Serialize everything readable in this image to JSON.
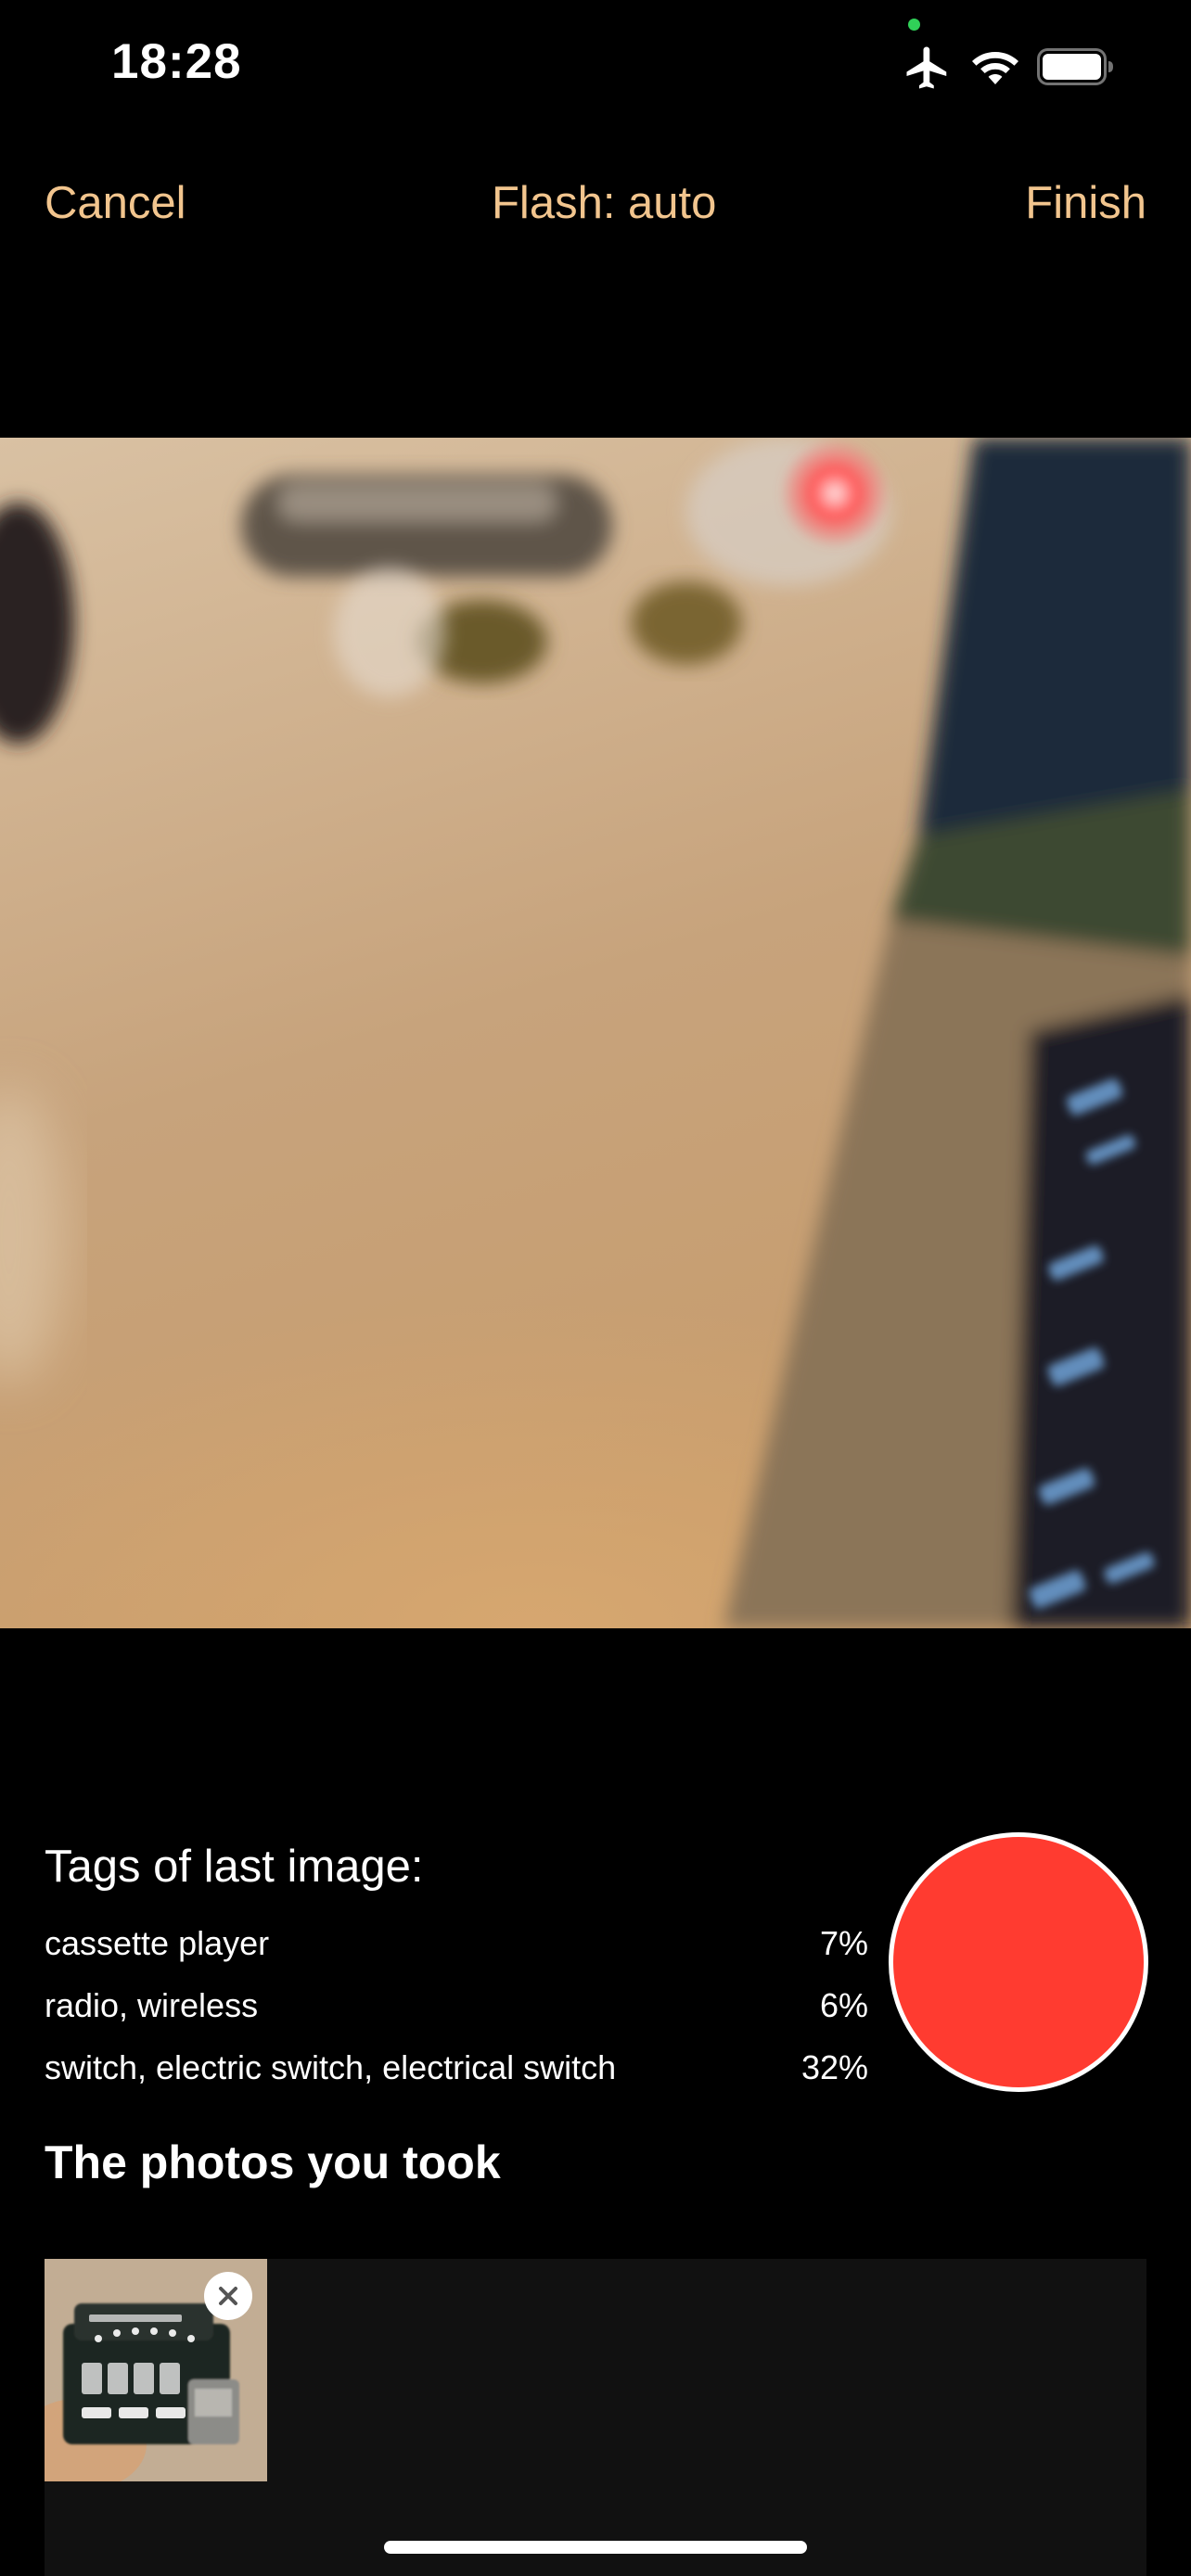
{
  "status_bar": {
    "time": "18:28",
    "icons": [
      "airplane-mode-icon",
      "wifi-icon",
      "battery-icon"
    ],
    "privacy_dot_color": "#30d158"
  },
  "nav": {
    "cancel_label": "Cancel",
    "flash_label": "Flash: auto",
    "finish_label": "Finish"
  },
  "tags": {
    "title": "Tags of last image:",
    "items": [
      {
        "name": "cassette player",
        "percent": "7%"
      },
      {
        "name": "radio, wireless",
        "percent": "6%"
      },
      {
        "name": "switch, electric switch, electrical switch",
        "percent": "32%"
      }
    ]
  },
  "shutter": {
    "icon": "record-button"
  },
  "photos": {
    "title": "The photos you took",
    "delete_icon": "close-icon"
  },
  "colors": {
    "accent": "#f2c58e",
    "shutter_red": "#ff3b30",
    "strip_background": "#111111"
  }
}
